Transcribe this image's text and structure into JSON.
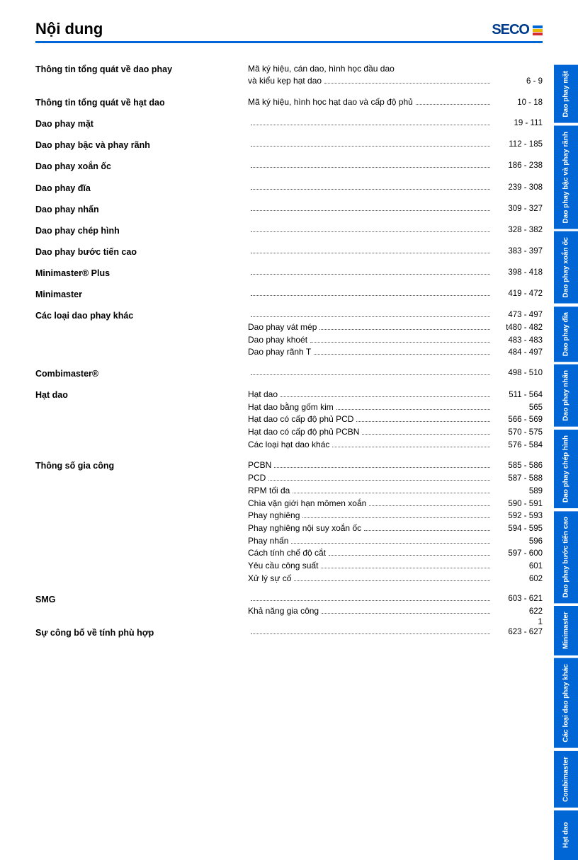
{
  "title": "Nội dung",
  "logo_text": "SECO",
  "page_number": "1",
  "side_tabs": [
    "Dao phay mặt",
    "Dao phay bậc và phay rãnh",
    "Dao phay xoắn ốc",
    "Dao phay đĩa",
    "Dao phay nhấn",
    "Dao phay chép hình",
    "Dao phay bước tiến cao",
    "Minimaster",
    "Các loại dao phay khác",
    "Combimaster",
    "Hạt dao"
  ],
  "sections": [
    {
      "label": "Thông tin tổng quát về dao phay",
      "lines": [
        {
          "text": "Mã ký hiệu, cán dao, hình học đầu dao",
          "pages": ""
        },
        {
          "text": "và kiểu kẹp hạt dao",
          "pages": "6 - 9"
        }
      ]
    },
    {
      "label": "Thông tin tổng quát về hạt dao",
      "lines": [
        {
          "text": "Mã ký hiệu, hình học hạt dao và cấp độ phủ",
          "pages": "10 - 18"
        }
      ]
    },
    {
      "label": "Dao phay mặt",
      "lines": [
        {
          "text": "",
          "pages": "19 - 111"
        }
      ]
    },
    {
      "label": "Dao phay bậc và phay rãnh",
      "lines": [
        {
          "text": "",
          "pages": "112 - 185"
        }
      ]
    },
    {
      "label": "Dao phay xoắn ốc",
      "lines": [
        {
          "text": "",
          "pages": "186 - 238"
        }
      ]
    },
    {
      "label": "Dao phay đĩa",
      "lines": [
        {
          "text": "",
          "pages": "239 - 308"
        }
      ]
    },
    {
      "label": "Dao phay nhấn",
      "lines": [
        {
          "text": "",
          "pages": "309 - 327"
        }
      ]
    },
    {
      "label": "Dao phay chép hình",
      "lines": [
        {
          "text": "",
          "pages": "328 - 382"
        }
      ]
    },
    {
      "label": "Dao phay bước tiến cao",
      "lines": [
        {
          "text": "",
          "pages": "383 - 397"
        }
      ]
    },
    {
      "label": "Minimaster® Plus",
      "lines": [
        {
          "text": "",
          "pages": "398 - 418"
        }
      ]
    },
    {
      "label": "Minimaster",
      "lines": [
        {
          "text": "",
          "pages": "419 - 472"
        }
      ]
    },
    {
      "label": "Các loại dao phay khác",
      "lines": [
        {
          "text": "",
          "pages": "473 - 497"
        },
        {
          "text": "Dao phay vát mép",
          "pages": "t480 - 482"
        },
        {
          "text": "Dao phay khoét",
          "pages": "483 - 483"
        },
        {
          "text": "Dao phay rãnh T",
          "pages": "484 - 497"
        }
      ]
    },
    {
      "label": "Combimaster®",
      "lines": [
        {
          "text": "",
          "pages": "498 - 510"
        }
      ]
    },
    {
      "label": "Hạt dao",
      "lines": [
        {
          "text": "Hạt dao",
          "pages": "511 - 564"
        },
        {
          "text": "Hạt dao bằng gốm kim",
          "pages": "565"
        },
        {
          "text": "Hạt dao có cấp độ phủ PCD",
          "pages": "566 - 569"
        },
        {
          "text": "Hạt dao có cấp độ phủ PCBN",
          "pages": "570 - 575"
        },
        {
          "text": "Các loại hạt dao khác",
          "pages": "576 - 584"
        }
      ]
    },
    {
      "label": "Thông số gia công",
      "lines": [
        {
          "text": "PCBN",
          "pages": "585 - 586"
        },
        {
          "text": "PCD",
          "pages": "587 - 588"
        },
        {
          "text": "RPM tối đa",
          "pages": "589"
        },
        {
          "text": "Chìa vặn giới hạn mômen xoắn",
          "pages": "590 - 591"
        },
        {
          "text": "Phay nghiêng",
          "pages": "592 - 593"
        },
        {
          "text": "Phay nghiêng nội suy xoắn ốc",
          "pages": "594 - 595"
        },
        {
          "text": "Phay nhấn",
          "pages": "596"
        },
        {
          "text": "Cách tính chế độ cắt",
          "pages": "597 - 600"
        },
        {
          "text": "Yêu cầu công suất",
          "pages": "601"
        },
        {
          "text": "Xử lý sự cố",
          "pages": "602"
        }
      ]
    },
    {
      "label": "SMG",
      "lines": [
        {
          "text": "",
          "pages": "603 - 621"
        },
        {
          "text": "Khả năng gia công",
          "pages": "622"
        }
      ]
    },
    {
      "label": "Sự công bố về tính phù hợp",
      "lines": [
        {
          "text": "",
          "pages": "623 - 627"
        }
      ]
    }
  ]
}
